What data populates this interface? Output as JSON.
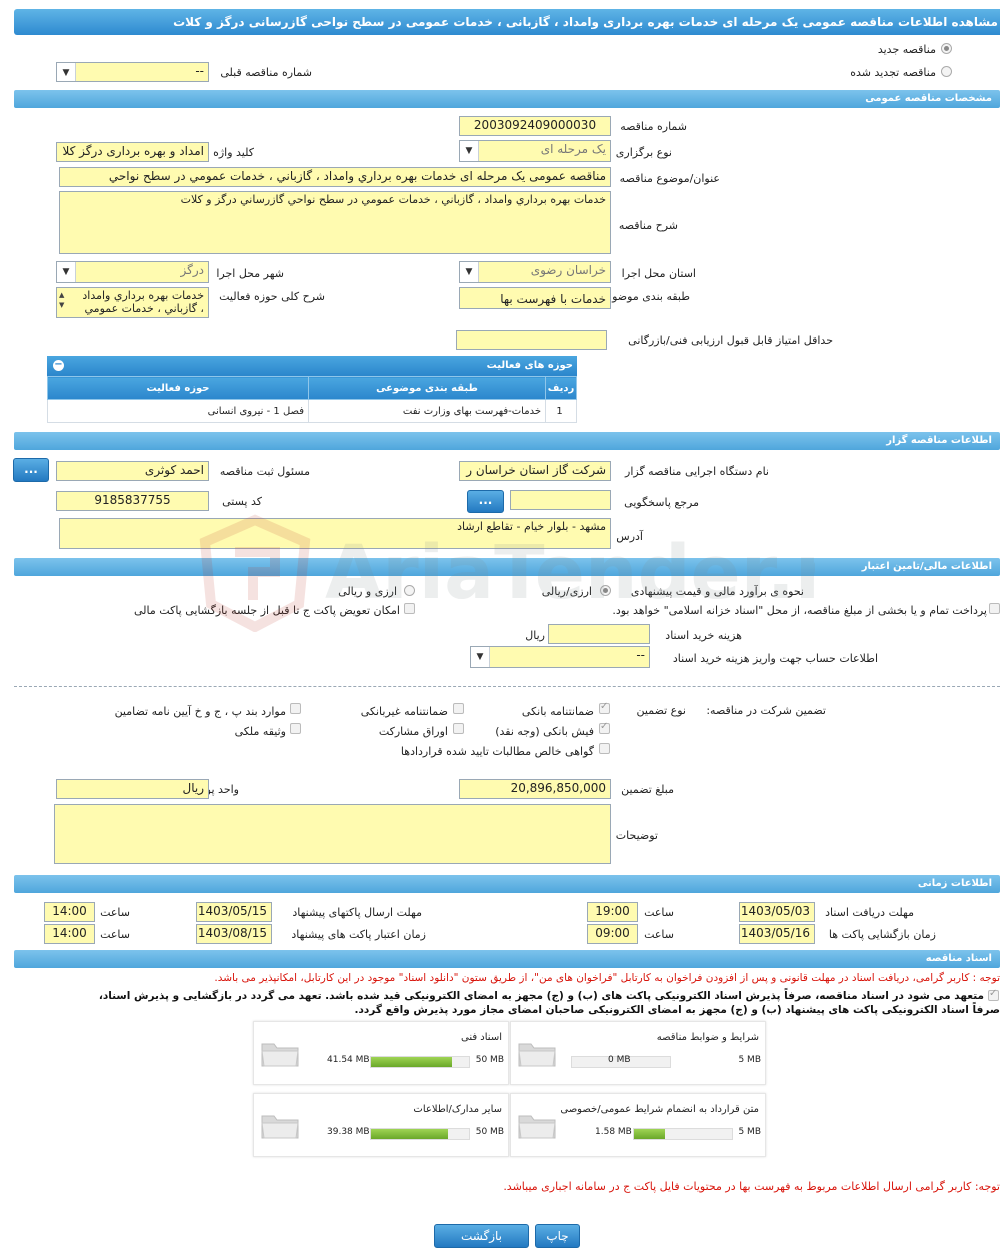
{
  "title": "مشاهده اطلاعات مناقصه عمومی یک مرحله ای خدمات بهره برداری وامداد ، گازبانی ، خدمات عمومی در سطح نواحی گازرسانی درگز و کلات",
  "top": {
    "new_tender": "مناقصه جدید",
    "renewed_tender": "مناقصه تجدید شده",
    "prev_number_label": "شماره مناقصه قبلی",
    "prev_number_value": "--"
  },
  "general": {
    "header": "مشخصات مناقصه عمومی",
    "number_label": "شماره مناقصه",
    "number_value": "2003092409000030",
    "type_label": "نوع برگزاری",
    "type_value": "یک مرحله ای",
    "keyword_label": "کلید واژه",
    "keyword_value": "امداد و بهره برداری درگز کلا",
    "subject_label": "عنوان/موضوع مناقصه",
    "subject_value": "مناقصه عمومی یک مرحله ای خدمات بهره برداري وامداد ، گازباني ، خدمات عمومي در سطح نواحي",
    "desc_label": "شرح مناقصه",
    "desc_value": "خدمات بهره برداري وامداد ، گازباني ، خدمات عمومي در سطح نواحي گازرساني درگز و کلات",
    "province_label": "استان محل اجرا",
    "province_value": "خراسان رضوی",
    "city_label": "شهر محل اجرا",
    "city_value": "درگز",
    "category_label": "طبقه بندی موضوعی",
    "category_value": "خدمات با فهرست بها",
    "activity_desc_label": "شرح کلی حوزه فعالیت",
    "activity_desc_line1": "خدمات بهره برداري وامداد",
    "activity_desc_line2": "، گازباني ، خدمات عمومي",
    "min_score_label": "حداقل امتیاز قابل قبول ارزیابی فنی/بازرگانی",
    "min_score_value": ""
  },
  "activity_table": {
    "title": "حوزه های فعالیت",
    "headers": [
      "ردیف",
      "طبقه بندی موضوعی",
      "حوزه فعالیت"
    ],
    "rows": [
      [
        "1",
        "خدمات-فهرست بهای وزارت نفت",
        "فصل 1 - نیروی انسانی"
      ]
    ]
  },
  "organizer": {
    "header": "اطلاعات مناقصه گزار",
    "org_label": "نام دستگاه اجرایی مناقصه گزار",
    "org_value": "شرکت گاز استان خراسان ر",
    "responsible_label": "مسئول ثبت مناقصه",
    "responsible_value": "احمد کوثری",
    "ref_label": "مرجع پاسخگویی",
    "ref_value": "",
    "postal_label": "کد پستی",
    "postal_value": "9185837755",
    "address_label": "آدرس",
    "address_value": "مشهد - بلوار خیام - تقاطع ارشاد",
    "more_btn": "..."
  },
  "finance": {
    "header": "اطلاعات مالی/تامین اعتبار",
    "estimate_label": "نحوه ی برآورد مالی و قیمت پیشنهادی",
    "opt_rial": "ارزی/ریالی",
    "opt_fx": "ارزی و ریالی",
    "treasury_text": "پرداخت تمام و یا بخشی از مبلغ مناقصه، از محل \"اسناد خزانه اسلامی\" خواهد بود.",
    "replace_text": "امکان تعویض پاکت ج تا قبل از جلسه بازگشایی پاکت مالی",
    "doc_cost_label": "هزینه خرید اسناد",
    "doc_cost_value": "",
    "doc_cost_unit": "ریال",
    "account_label": "اطلاعات حساب جهت واریز هزینه خرید اسناد",
    "account_value": "--"
  },
  "guarantee": {
    "label": "تضمین شرکت در مناقصه:",
    "type_label": "نوع تضمین",
    "options": {
      "bank_guarantee": "ضمانتنامه بانکی",
      "nonbank_guarantee": "ضمانتنامه غیربانکی",
      "clauses": "موارد بند پ ، ج و خ آیین نامه تضامین",
      "bank_receipt": "فیش بانکی (وجه نقد)",
      "bonds": "اوراق مشارکت",
      "property": "وثیقه ملکی",
      "receivables": "گواهی خالص مطالبات تایید شده قراردادها"
    },
    "amount_label": "مبلغ تضمین",
    "amount_value": "20,896,850,000",
    "currency_label": "واحد پول",
    "currency_value": "ریال",
    "notes_label": "توضیحات",
    "notes_value": ""
  },
  "timing": {
    "header": "اطلاعات زمانی",
    "receive_deadline_label": "مهلت دریافت اسناد",
    "receive_deadline_date": "1403/05/03",
    "receive_deadline_time": "19:00",
    "send_deadline_label": "مهلت ارسال پاکتهای پیشنهاد",
    "send_deadline_date": "1403/05/15",
    "send_deadline_time": "14:00",
    "opening_label": "زمان بازگشایی پاکت ها",
    "opening_date": "1403/05/16",
    "opening_time": "09:00",
    "validity_label": "زمان اعتبار پاکت های پیشنهاد",
    "validity_date": "1403/08/15",
    "validity_time": "14:00",
    "time_word": "ساعت"
  },
  "documents": {
    "header": "اسناد مناقصه",
    "notice_red": "توجه : کاربر گرامی، دریافت اسناد در مهلت قانونی و پس از افزودن فراخوان به کارتابل \"فراخوان های من\"، از طریق ستون \"دانلود اسناد\" موجود در این کارتابل، امکانپذیر می باشد.",
    "commit_line1": "متعهد می شود در اسناد مناقصه، صرفاً پذیرش اسناد الکترونیکی پاکت های (ب) و (ج) مجهز به امضای الکترونیکی قید شده باشد. تعهد می گردد در بازگشایی و پذیرش اسناد،",
    "commit_line2": "صرفاً اسناد الکترونیکی پاکت های پیشنهاد (ب) و (ج) مجهز به امضای الکترونیکی صاحبان امضای مجاز مورد پذیرش واقع گردد.",
    "files": [
      {
        "name": "شرایط و ضوابط مناقصه",
        "size": "0 MB",
        "max": "5 MB",
        "fill": 0.0
      },
      {
        "name": "اسناد فنی",
        "size": "41.54 MB",
        "max": "50 MB",
        "fill": 0.83
      },
      {
        "name": "متن قرارداد به انضمام شرایط عمومی/خصوصی",
        "size": "1.58 MB",
        "max": "5 MB",
        "fill": 0.32
      },
      {
        "name": "سایر مدارک/اطلاعات",
        "size": "39.38 MB",
        "max": "50 MB",
        "fill": 0.79
      }
    ],
    "notice_red2": "توجه: کاربر گرامی ارسال اطلاعات مربوط به فهرست بها در محتویات فایل پاکت ج در سامانه اجباری میباشد."
  },
  "footer": {
    "print_label": "چاپ",
    "back_label": "بازگشت"
  },
  "watermark_text": "AriaTender.neT"
}
